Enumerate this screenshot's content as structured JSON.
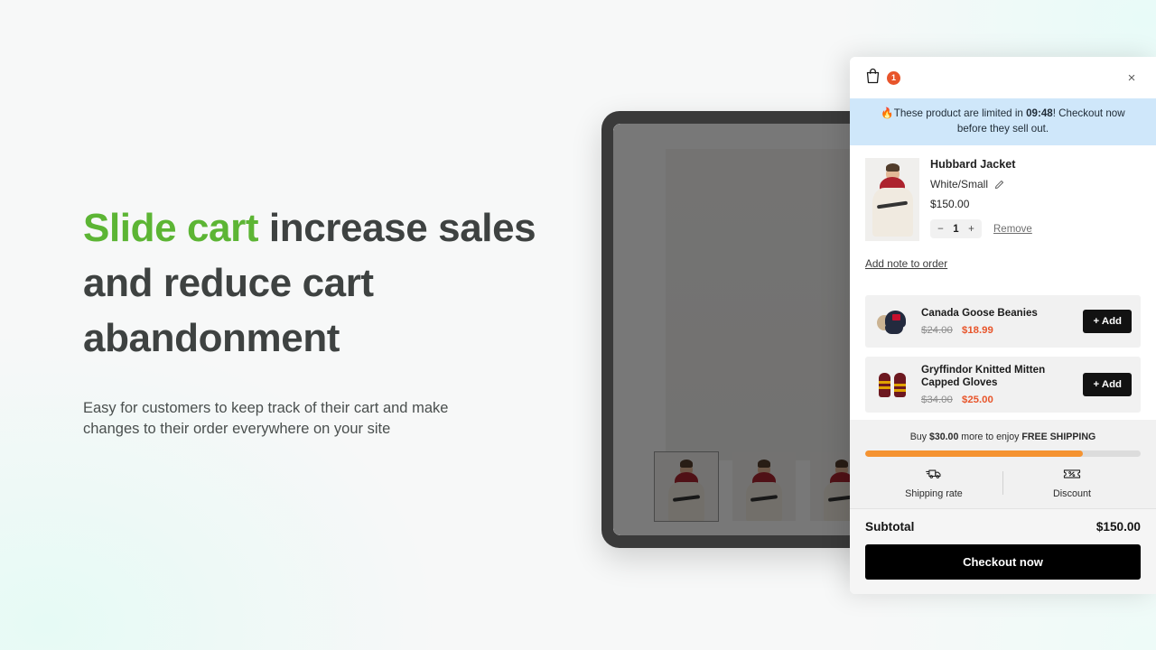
{
  "hero": {
    "headline_accent": "Slide cart",
    "headline_rest": " increase sales and reduce cart abandonment",
    "subcopy": "Easy for customers to keep track of their cart and make changes to their order everywhere on your site",
    "accent_color": "#5cb534",
    "heading_color": "#3e4241"
  },
  "cart": {
    "bag_icon": "shopping-bag-icon",
    "item_count": "1",
    "close_label": "×",
    "announcement": {
      "fire_icon": "🔥",
      "prefix": "These product are limited in ",
      "timer": "09:48",
      "suffix": "! Checkout now before they sell out.",
      "background": "#cfe7fa"
    },
    "line_item": {
      "title": "Hubbard Jacket",
      "variant": "White/Small",
      "edit_icon": "pencil-icon",
      "price": "$150.00",
      "decrement": "−",
      "quantity": "1",
      "increment": "+",
      "remove_label": "Remove"
    },
    "note_link": "Add note to order",
    "upsells": [
      {
        "title": "Canada Goose Beanies",
        "old_price": "$24.00",
        "new_price": "$18.99",
        "add_label": "+ Add",
        "image": "trapper-hat"
      },
      {
        "title": "Gryffindor Knitted Mitten Capped Gloves",
        "old_price": "$34.00",
        "new_price": "$25.00",
        "add_label": "+ Add",
        "image": "knitted-mittens"
      }
    ],
    "footer": {
      "shipping_prefix": "Buy ",
      "shipping_amount": "$30.00",
      "shipping_middle": " more to enjoy ",
      "shipping_goal": "FREE SHIPPING",
      "progress_percent": 79,
      "progress_color": "#f59331",
      "perks": [
        {
          "label": "Shipping rate",
          "icon": "truck-icon"
        },
        {
          "label": "Discount",
          "icon": "coupon-icon"
        }
      ],
      "subtotal_label": "Subtotal",
      "subtotal_value": "$150.00",
      "checkout_label": "Checkout now"
    }
  },
  "device": {
    "thumbnails": [
      "thumb-1-selected",
      "thumb-2",
      "thumb-3"
    ]
  }
}
